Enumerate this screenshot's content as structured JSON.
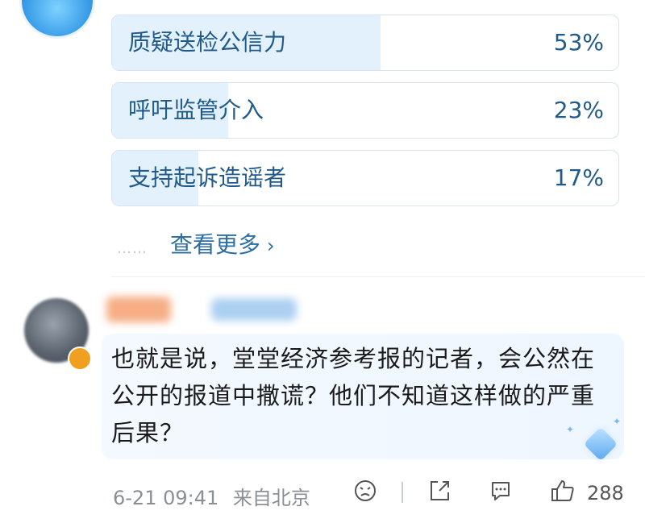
{
  "poll": {
    "options": [
      {
        "label": "质疑送检公信力",
        "percent": "53%",
        "fraction": 0.53
      },
      {
        "label": "呼吁监管介入",
        "percent": "23%",
        "fraction": 0.23
      },
      {
        "label": "支持起诉造谣者",
        "percent": "17%",
        "fraction": 0.17
      }
    ],
    "more_label": "查看更多",
    "more_prefix": "……"
  },
  "comment": {
    "text": "也就是说，堂堂经济参考报的记者，会公然在公开的报道中撒谎？他们不知道这样做的严重后果？",
    "timestamp": "6-21 09:41",
    "location": "来自北京",
    "like_count": "288"
  },
  "icons": {
    "poll_avatar": "mascot-avatar-icon",
    "comment_avatar": "user-avatar",
    "diamond": "diamond-badge-icon",
    "dislike": "frown-face-icon",
    "share": "share-icon",
    "reply": "comment-icon",
    "like": "thumbs-up-icon"
  },
  "colors": {
    "accent": "#1f5a8a",
    "poll_fill": "#e3f1fc",
    "bubble": "#f4f9ff"
  }
}
